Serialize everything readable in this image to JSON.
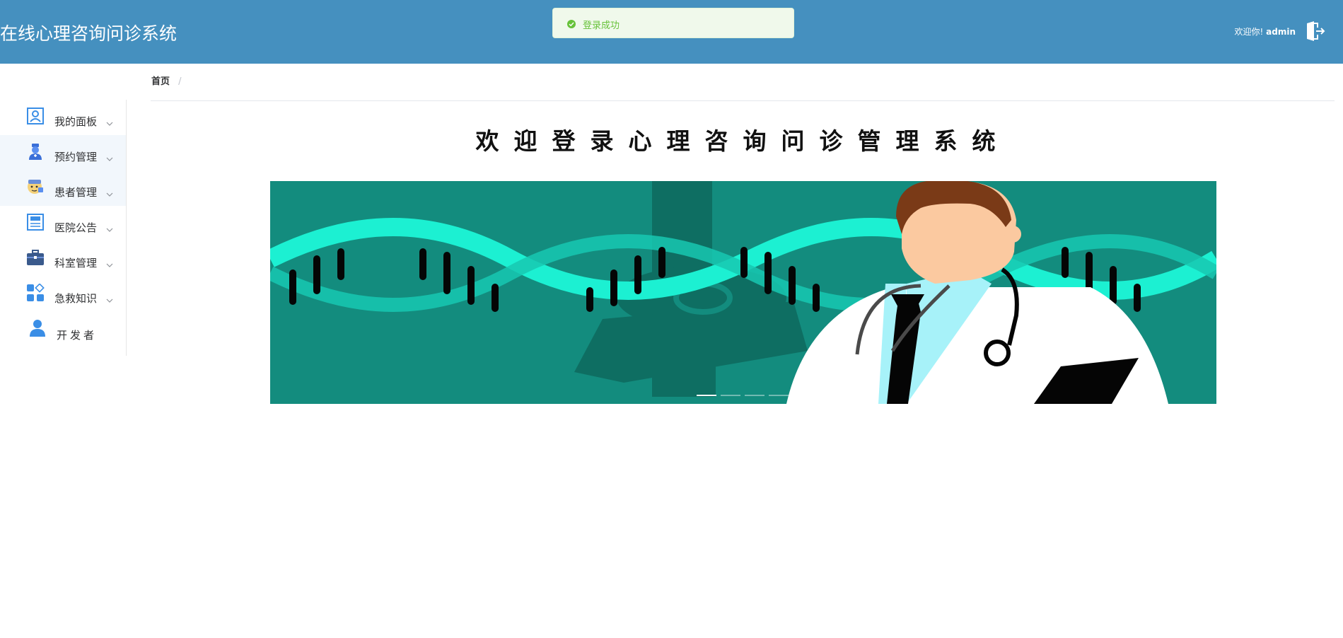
{
  "header": {
    "app_title": "在线心理咨询问诊系统",
    "welcome_prefix": "欢迎你!",
    "username": "admin",
    "logout_icon": "logout-door-icon",
    "bg_color": "#4590bf"
  },
  "toast": {
    "message": "登录成功",
    "icon": "success-check-icon",
    "color": "#67c23a"
  },
  "sidebar": {
    "items": [
      {
        "label": "我的面板",
        "icon": "user-panel-icon"
      },
      {
        "label": "预约管理",
        "icon": "nurse-appointment-icon"
      },
      {
        "label": "患者管理",
        "icon": "patient-icon"
      },
      {
        "label": "医院公告",
        "icon": "news-announcement-icon"
      },
      {
        "label": "科室管理",
        "icon": "briefcase-icon"
      },
      {
        "label": "急救知识",
        "icon": "apps-grid-icon"
      },
      {
        "label": "开发者",
        "icon": "developer-person-icon"
      }
    ]
  },
  "breadcrumb": {
    "home": "首页",
    "separator": "/"
  },
  "main": {
    "welcome_title": "欢迎登录心理咨询问诊管理系统",
    "carousel": {
      "slide_count": 4,
      "active_index": 0
    }
  }
}
